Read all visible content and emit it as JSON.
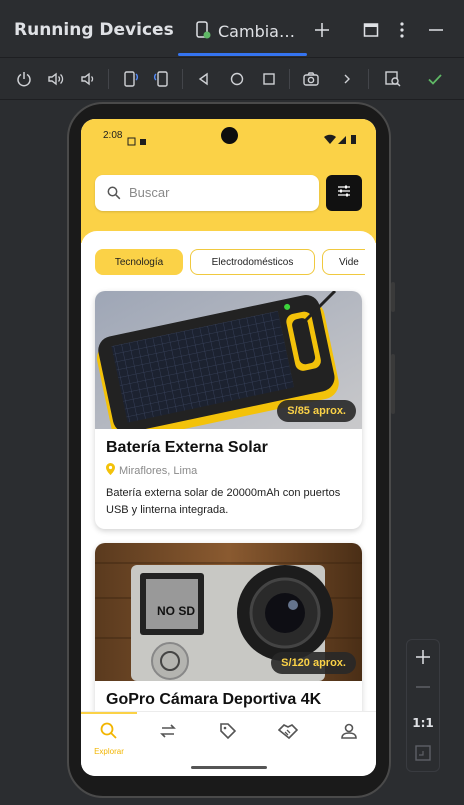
{
  "ide": {
    "panel_title": "Running Devices",
    "tab_label": "Cambia…",
    "zoom_ratio": "1:1"
  },
  "app": {
    "status_time": "2:08",
    "search_placeholder": "Buscar",
    "categories": [
      "Tecnología",
      "Electrodomésticos",
      "Vide"
    ],
    "products": [
      {
        "title": "Batería Externa Solar",
        "price": "S/85 aprox.",
        "location": "Miraflores, Lima",
        "description": "Batería externa solar de 20000mAh con puertos USB y linterna integrada."
      },
      {
        "title": "GoPro Cámara Deportiva 4K",
        "price": "S/120 aprox."
      }
    ],
    "nav": {
      "explore_label": "Explorar"
    },
    "colors": {
      "accent": "#fbd247",
      "dark": "#111111"
    }
  }
}
